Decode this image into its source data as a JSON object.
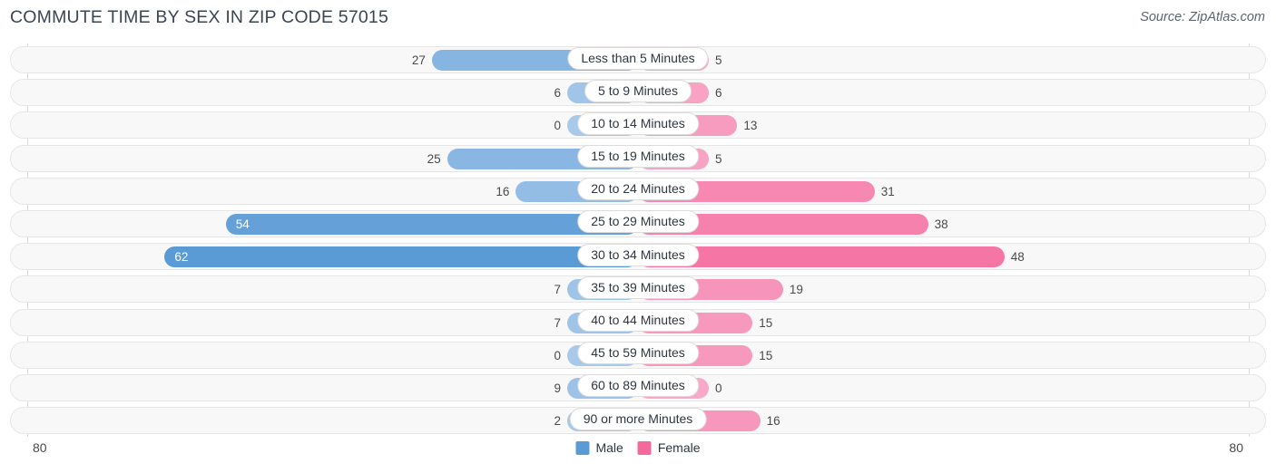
{
  "header": {
    "title": "COMMUTE TIME BY SEX IN ZIP CODE 57015",
    "source": "Source: ZipAtlas.com"
  },
  "legend": {
    "items": [
      {
        "label": "Male",
        "color": "#5b9bd5"
      },
      {
        "label": "Female",
        "color": "#f4689b"
      }
    ]
  },
  "axis": {
    "left_max": "80",
    "right_max": "80"
  },
  "chart_data": {
    "type": "bar",
    "orientation": "horizontal-diverging",
    "title": "COMMUTE TIME BY SEX IN ZIP CODE 57015",
    "xlabel": "",
    "ylabel": "",
    "xlim": [
      80,
      80
    ],
    "grid": false,
    "legend_position": "bottom-center",
    "categories": [
      "Less than 5 Minutes",
      "5 to 9 Minutes",
      "10 to 14 Minutes",
      "15 to 19 Minutes",
      "20 to 24 Minutes",
      "25 to 29 Minutes",
      "30 to 34 Minutes",
      "35 to 39 Minutes",
      "40 to 44 Minutes",
      "45 to 59 Minutes",
      "60 to 89 Minutes",
      "90 or more Minutes"
    ],
    "series": [
      {
        "name": "Male",
        "color": "#5b9bd5",
        "values": [
          27,
          6,
          0,
          25,
          16,
          54,
          62,
          7,
          7,
          0,
          9,
          2
        ]
      },
      {
        "name": "Female",
        "color": "#f4689b",
        "values": [
          5,
          6,
          13,
          5,
          31,
          38,
          48,
          19,
          15,
          15,
          0,
          16
        ]
      }
    ]
  },
  "rows": [
    {
      "label": "Less than 5 Minutes",
      "male": "27",
      "female": "5",
      "male_value": 27,
      "female_value": 5
    },
    {
      "label": "5 to 9 Minutes",
      "male": "6",
      "female": "6",
      "male_value": 6,
      "female_value": 6
    },
    {
      "label": "10 to 14 Minutes",
      "male": "0",
      "female": "13",
      "male_value": 0,
      "female_value": 13
    },
    {
      "label": "15 to 19 Minutes",
      "male": "25",
      "female": "5",
      "male_value": 25,
      "female_value": 5
    },
    {
      "label": "20 to 24 Minutes",
      "male": "16",
      "female": "31",
      "male_value": 16,
      "female_value": 31
    },
    {
      "label": "25 to 29 Minutes",
      "male": "54",
      "female": "38",
      "male_value": 54,
      "female_value": 38
    },
    {
      "label": "30 to 34 Minutes",
      "male": "62",
      "female": "48",
      "male_value": 62,
      "female_value": 48
    },
    {
      "label": "35 to 39 Minutes",
      "male": "7",
      "female": "19",
      "male_value": 7,
      "female_value": 19
    },
    {
      "label": "40 to 44 Minutes",
      "male": "7",
      "female": "15",
      "male_value": 7,
      "female_value": 15
    },
    {
      "label": "45 to 59 Minutes",
      "male": "0",
      "female": "15",
      "male_value": 0,
      "female_value": 15
    },
    {
      "label": "60 to 89 Minutes",
      "male": "9",
      "female": "0",
      "male_value": 9,
      "female_value": 0
    },
    {
      "label": "90 or more Minutes",
      "male": "2",
      "female": "16",
      "male_value": 2,
      "female_value": 16
    }
  ]
}
